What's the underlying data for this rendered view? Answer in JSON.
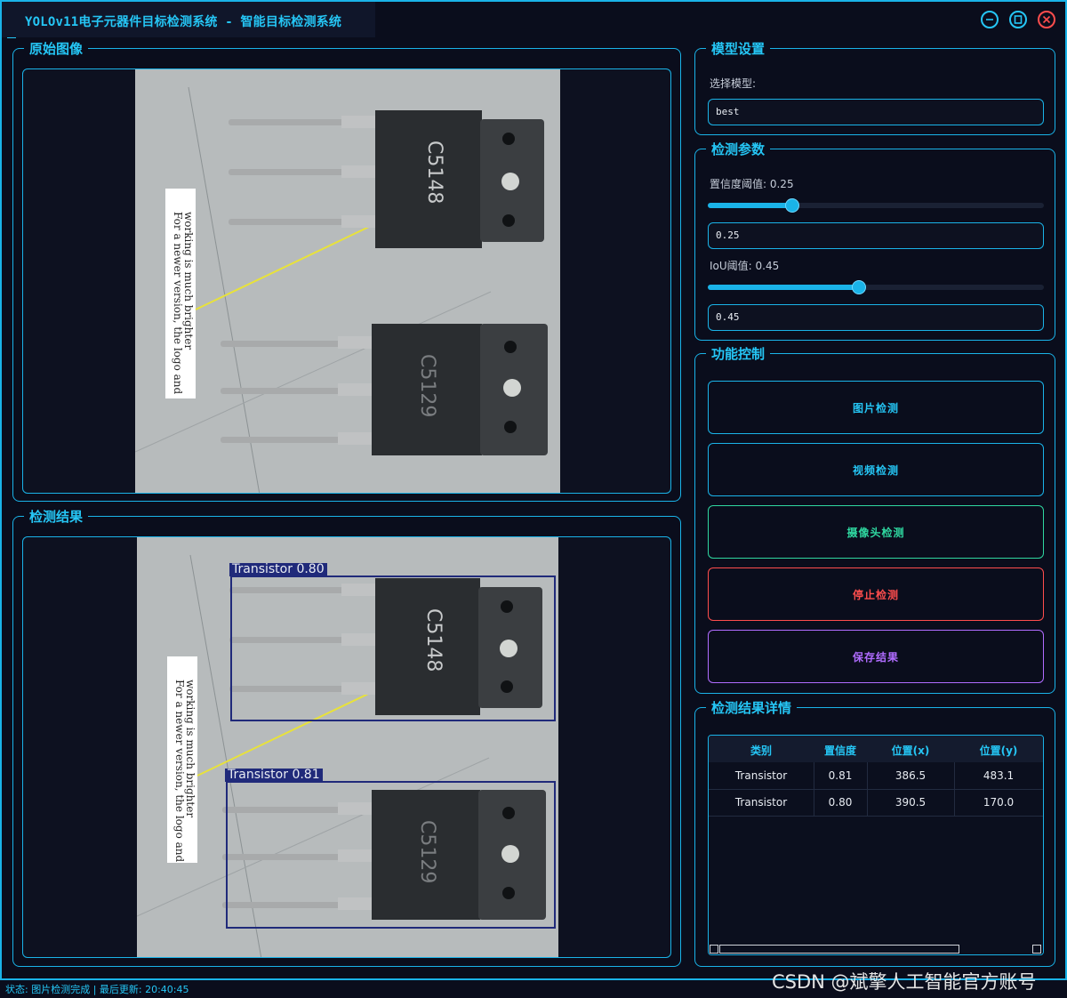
{
  "window": {
    "title": "YOLOv11电子元器件目标检测系统 - 智能目标检测系统"
  },
  "panels": {
    "original": "原始图像",
    "result": "检测结果",
    "model": "模型设置",
    "params": "检测参数",
    "control": "功能控制",
    "details": "检测结果详情"
  },
  "model": {
    "select_label": "选择模型:",
    "value": "best"
  },
  "params": {
    "confidence": {
      "label": "置信度阈值: 0.25",
      "value": 0.25,
      "input": "0.25"
    },
    "iou": {
      "label": "IoU阈值: 0.45",
      "value": 0.45,
      "input": "0.45"
    }
  },
  "buttons": [
    {
      "label": "图片检测",
      "color": "#25c6f5"
    },
    {
      "label": "视频检测",
      "color": "#25c6f5"
    },
    {
      "label": "摄像头检测",
      "color": "#2fd7a0"
    },
    {
      "label": "停止检测",
      "color": "#ff4d4d"
    },
    {
      "label": "保存结果",
      "color": "#b06cff"
    }
  ],
  "detections": [
    {
      "label": "Transistor 0.80"
    },
    {
      "label": "Transistor 0.81"
    }
  ],
  "table": {
    "headers": [
      "类别",
      "置信度",
      "位置(x)",
      "位置(y)"
    ],
    "rows": [
      [
        "Transistor",
        "0.81",
        "386.5",
        "483.1"
      ],
      [
        "Transistor",
        "0.80",
        "390.5",
        "170.0"
      ]
    ]
  },
  "status": "状态: 图片检测完成 | 最后更新: 20:40:45",
  "watermark": "CSDN @斌擎人工智能官方账号",
  "colors": {
    "accent": "#1ab3e8",
    "background": "#0a0d1c",
    "stop": "#ff4d4d",
    "camera": "#2fd7a0",
    "save": "#b06cff"
  }
}
